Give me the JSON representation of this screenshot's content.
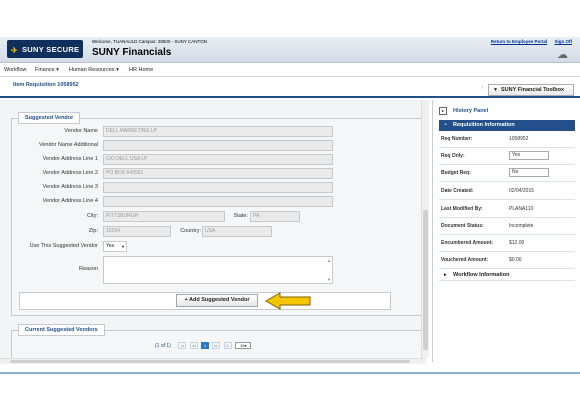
{
  "header": {
    "logo_text": "SUNY SECURE",
    "welcome_text": "Welcome, TUANAULD    Campus: 28500 - SUNY CANTON",
    "app_title": "SUNY Financials",
    "return_link": "Return to Employee Portal",
    "signoff_link": "Sign Off"
  },
  "menu": {
    "items": [
      "Workflow",
      "Finance ▾",
      "Human Resources ▾",
      "HR Home"
    ]
  },
  "page": {
    "title": "Item Requisition 1058952",
    "toolbox_label": "SUNY Financial Toolbox"
  },
  "vendor_form": {
    "legend": "Suggested Vendor",
    "labels": {
      "vendor_name": "Vendor Name",
      "vendor_name_additional": "Vendor Name Additional",
      "addr1": "Vendor Address Line 1",
      "addr2": "Vendor Address Line 2",
      "addr3": "Vendor Address Line 3",
      "addr4": "Vendor Address Line 4",
      "city": "City",
      "state": "State",
      "zip": "Zip",
      "country": "Country",
      "use_suggested": "Use This Suggested Vendor",
      "reason": "Reason"
    },
    "values": {
      "vendor_name": "DELL MARKETING LP",
      "vendor_name_additional": "",
      "addr1": "C/O DELL USA LP",
      "addr2": "PO BOX 643561",
      "addr3": "",
      "addr4": "",
      "city": "PITTSBURGH",
      "state": "PA",
      "zip": "15264",
      "country": "USA",
      "use_suggested": "Yes",
      "reason": ""
    },
    "add_button": "+ Add Suggested Vendor"
  },
  "current_vendors": {
    "legend": "Current Suggested Vendors",
    "pager_label": "(1 of 1)",
    "current_page": "1",
    "page_size": "10"
  },
  "right_panel": {
    "history_label": "History Panel",
    "req_info_label": "Requisition Information",
    "rows": [
      {
        "label": "Req Number:",
        "value": "1058952"
      },
      {
        "label": "Req Only:",
        "value": "Yes"
      },
      {
        "label": "Budget Req:",
        "value": "No"
      },
      {
        "label": "Date Created:",
        "value": "02/04/2015"
      },
      {
        "label": "Last Modified By:",
        "value": "PLANA110"
      },
      {
        "label": "Document Status:",
        "value": "Incomplete"
      },
      {
        "label": "Encumbered Amount:",
        "value": "$12.00"
      },
      {
        "label": "Vouchered Amount:",
        "value": "$0.00"
      }
    ],
    "workflow_label": "Workflow Information"
  },
  "colors": {
    "brand_navy": "#0f2f5c",
    "accent_blue": "#23508a",
    "arrow_yellow": "#f5c600"
  }
}
